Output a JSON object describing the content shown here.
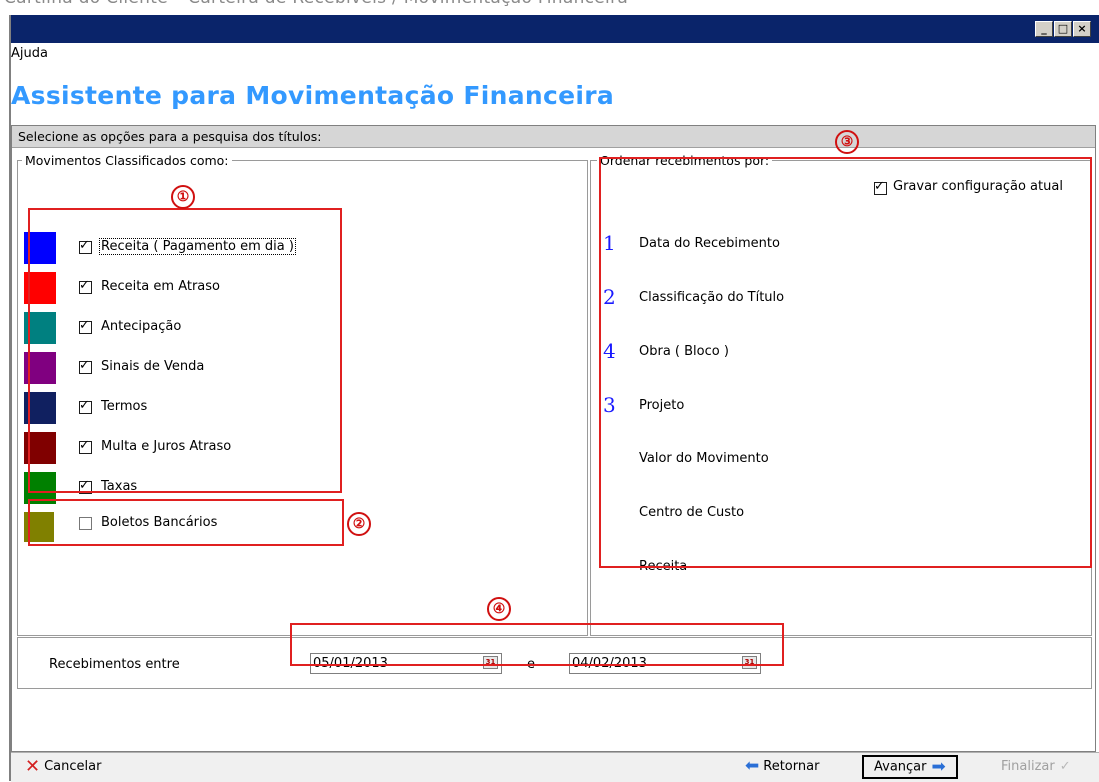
{
  "doc_caption": "Cartilha do Cliente – Carteira de Recebíveis / Movimentação Financeira",
  "window": {
    "controls": {
      "minimize": "_",
      "maximize": "□",
      "close": "×"
    }
  },
  "menu": {
    "help": "Ajuda"
  },
  "wizard_title": "Assistente para Movimentação Financeira",
  "options_header": "Selecione as opções para a pesquisa dos títulos:",
  "movements": {
    "legend": "Movimentos Classificados como:",
    "items": [
      {
        "label": "Receita ( Pagamento em dia )",
        "color": "#0000ff",
        "checked": true
      },
      {
        "label": "Receita em Atraso",
        "color": "#ff0000",
        "checked": true
      },
      {
        "label": "Antecipação",
        "color": "#008080",
        "checked": true
      },
      {
        "label": "Sinais de Venda",
        "color": "#800080",
        "checked": true
      },
      {
        "label": "Termos",
        "color": "#102060",
        "checked": true
      },
      {
        "label": "Multa e Juros Atraso",
        "color": "#800000",
        "checked": true
      },
      {
        "label": "Taxas",
        "color": "#008000",
        "checked": true
      }
    ],
    "boleto": {
      "label": "Boletos Bancários",
      "color": "#808000",
      "checked": false
    }
  },
  "sort": {
    "legend": "Ordenar recebimentos por:",
    "save_config": {
      "label": "Gravar configuração atual",
      "checked": true
    },
    "items": [
      {
        "rank": "1",
        "label": "Data do Recebimento"
      },
      {
        "rank": "2",
        "label": "Classificação do Título"
      },
      {
        "rank": "4",
        "label": "Obra ( Bloco )"
      },
      {
        "rank": "3",
        "label": "Projeto"
      },
      {
        "rank": "",
        "label": "Valor  do Movimento"
      },
      {
        "rank": "",
        "label": "Centro de Custo"
      },
      {
        "rank": "",
        "label": "Receita"
      }
    ]
  },
  "date_range": {
    "label": "Recebimentos entre",
    "start": "05/01/2013",
    "separator": "e",
    "end": "04/02/2013"
  },
  "callouts": [
    "①",
    "②",
    "③",
    "④"
  ],
  "buttons": {
    "cancel": "Cancelar",
    "back": "Retornar",
    "next": "Avançar",
    "finish": "Finalizar"
  },
  "colors": {
    "title_bar": "#0a246a",
    "wizard_title": "#3399ff",
    "highlight": "#e02020"
  }
}
